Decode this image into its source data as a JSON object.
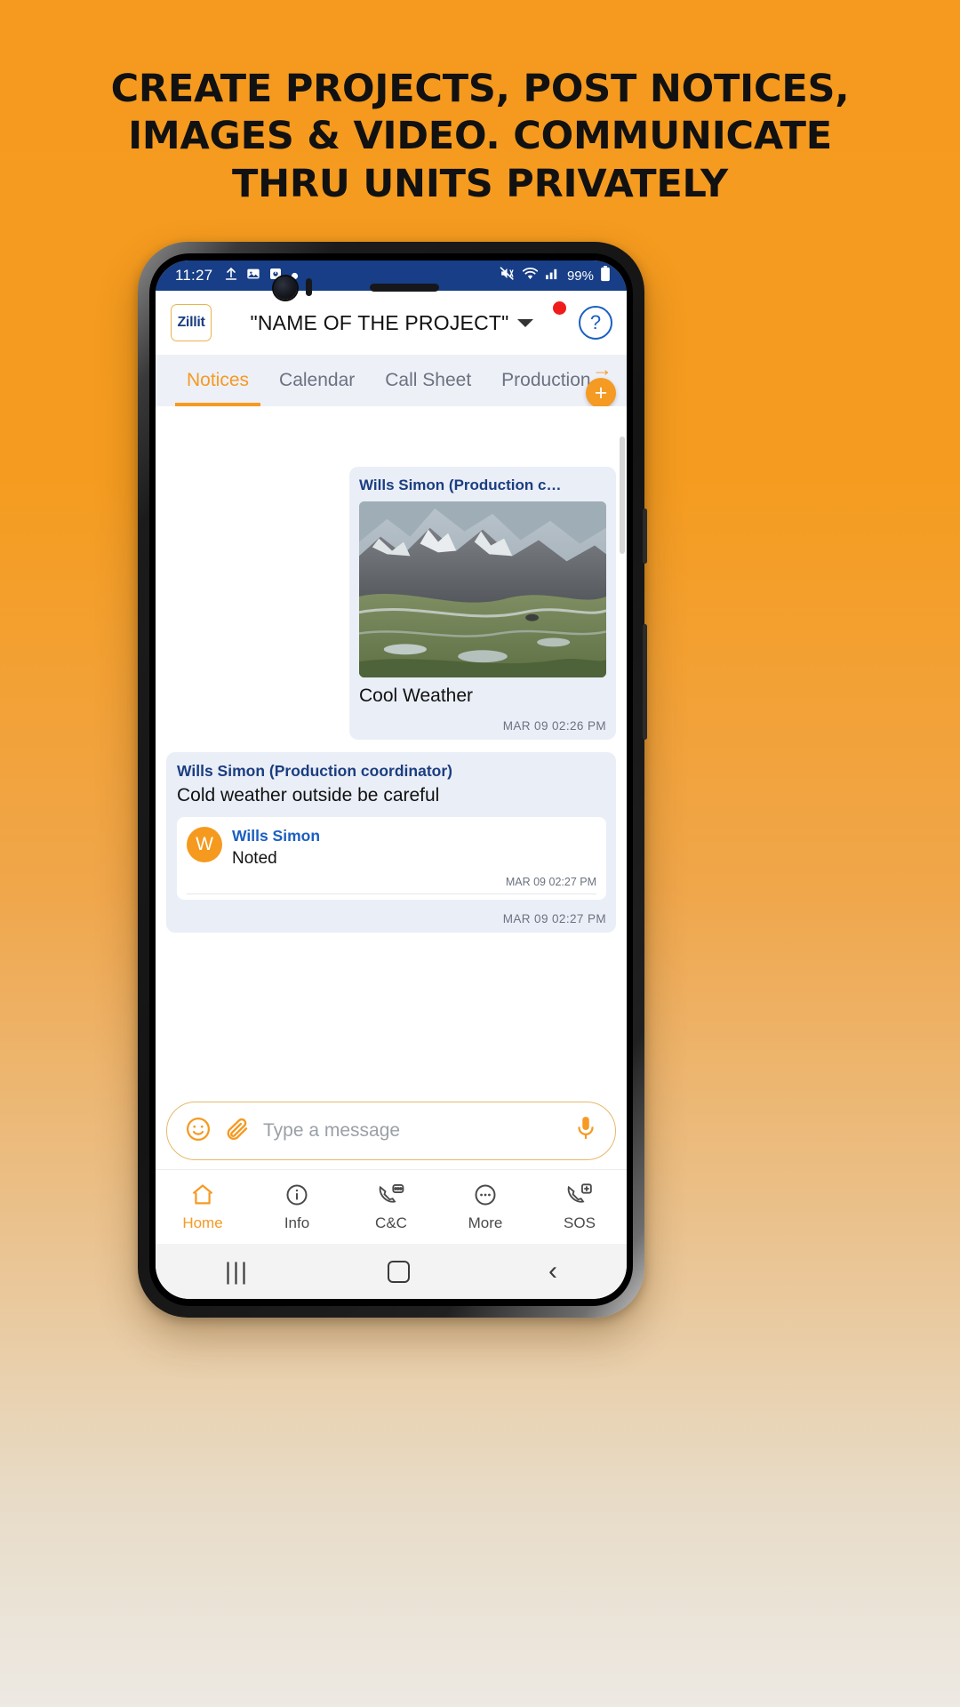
{
  "headline": {
    "line1": "CREATE PROJECTS, POST NOTICES,",
    "line2": "IMAGES & VIDEO. COMMUNICATE",
    "line3": "THRU UNITS PRIVATELY"
  },
  "colors": {
    "brand_orange": "#F59A23",
    "brand_navy": "#1B3E80",
    "status_bar": "#173E86",
    "bubble": "#EAEEF7",
    "tabs_bg": "#EDF0F7"
  },
  "status_bar": {
    "time": "11:27",
    "battery_percent": "99%",
    "left_icons": [
      "upload-icon",
      "image-icon",
      "screenshot-icon",
      "dot-icon"
    ],
    "right_icons": [
      "mute-icon",
      "wifi-icon",
      "signal-icon",
      "battery-icon"
    ]
  },
  "app_header": {
    "logo_text": "Zillit",
    "project_title": "\"NAME OF THE PROJECT\"",
    "dropdown_icon": "chevron-down-icon",
    "notification_badge": "",
    "help_label": "?"
  },
  "tabs": {
    "items": [
      {
        "label": "Notices",
        "active": true
      },
      {
        "label": "Calendar",
        "active": false
      },
      {
        "label": "Call Sheet",
        "active": false
      },
      {
        "label": "Production",
        "active": false
      }
    ],
    "scroll_arrow": "→",
    "add_button_label": "+"
  },
  "chat": {
    "messages": [
      {
        "sender": "Wills Simon (Production c…",
        "type": "image",
        "caption": "Cool Weather",
        "timestamp": "MAR 09 02:26 PM",
        "align": "right"
      },
      {
        "sender": "Wills Simon (Production coordinator)",
        "type": "text",
        "body": "Cold weather outside be careful",
        "timestamp": "MAR 09 02:27 PM",
        "align": "left",
        "reply": {
          "avatar_initial": "W",
          "name": "Wills Simon",
          "text": "Noted",
          "timestamp": "MAR 09 02:27 PM"
        }
      }
    ]
  },
  "composer": {
    "emoji_icon": "emoji-icon",
    "attach_icon": "paperclip-icon",
    "placeholder": "Type a message",
    "mic_icon": "microphone-icon"
  },
  "bottom_nav": {
    "items": [
      {
        "label": "Home",
        "icon": "home-icon",
        "active": true
      },
      {
        "label": "Info",
        "icon": "info-icon",
        "active": false
      },
      {
        "label": "C&C",
        "icon": "phone-chat-icon",
        "active": false
      },
      {
        "label": "More",
        "icon": "more-dots-icon",
        "active": false
      },
      {
        "label": "SOS",
        "icon": "emergency-call-icon",
        "active": false
      }
    ]
  },
  "android_nav": {
    "recents": "|||",
    "home": "home-square-icon",
    "back": "‹"
  }
}
